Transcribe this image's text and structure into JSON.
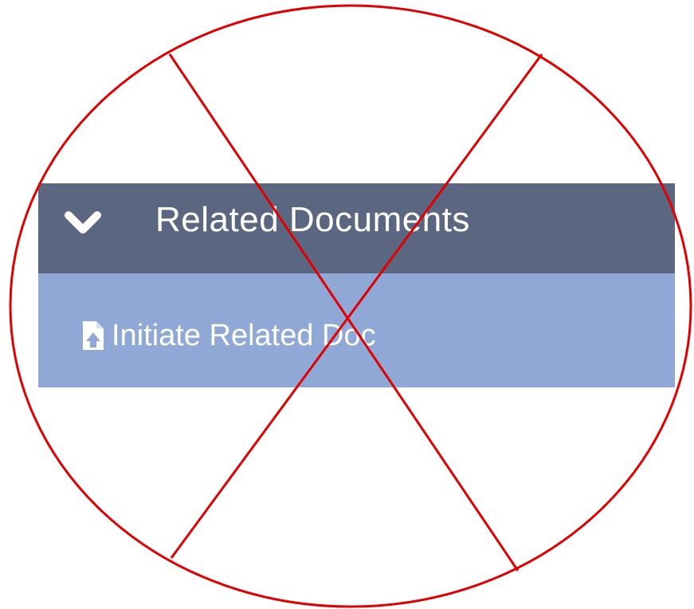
{
  "panel": {
    "title": "Related Documents",
    "collapse_icon": "chevron-down-icon",
    "actions": [
      {
        "label": "Initiate Related Doc",
        "icon": "upload-document-icon"
      }
    ]
  },
  "overlay": {
    "marks": [
      "circle-outline",
      "diagonal-cross"
    ],
    "color": "#e00000"
  },
  "colors": {
    "header_background": "#5b6680",
    "body_background": "#8fa8d6",
    "text": "#ffffff"
  }
}
